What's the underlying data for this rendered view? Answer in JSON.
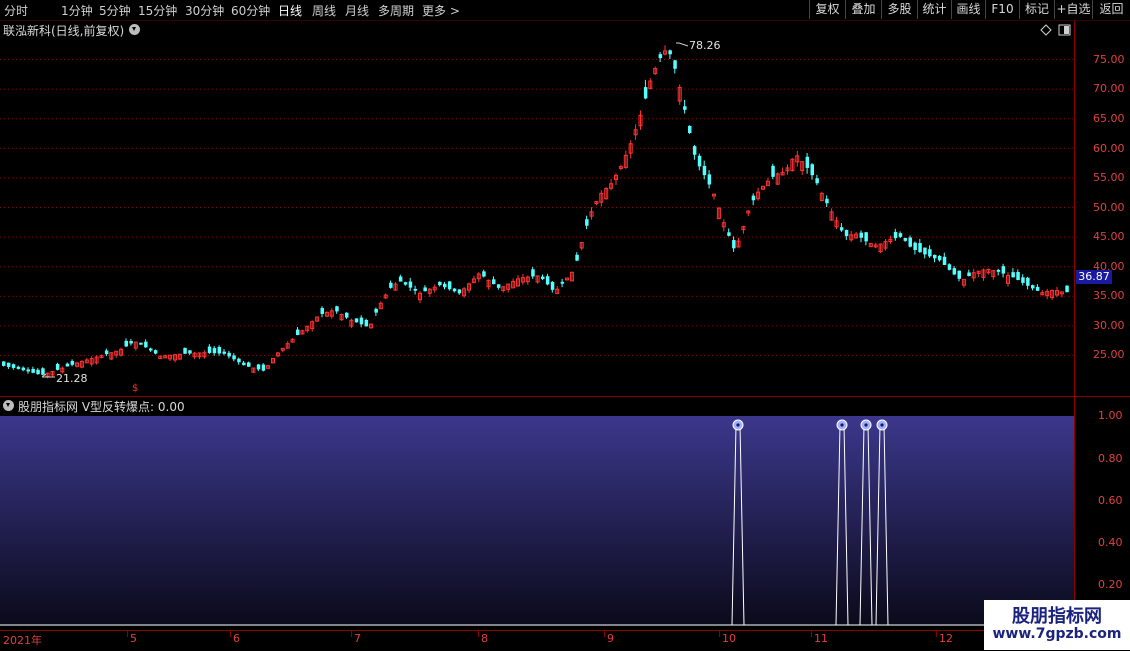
{
  "toolbar": {
    "periods": [
      "分时",
      "1分钟",
      "5分钟",
      "15分钟",
      "30分钟",
      "60分钟",
      "日线",
      "周线",
      "月线",
      "多周期",
      "更多 >"
    ],
    "active_period": "日线",
    "right_buttons": [
      "复权",
      "叠加",
      "多股",
      "统计",
      "画线",
      "F10",
      "标记",
      "+自选",
      "返回"
    ]
  },
  "stock": {
    "title": "联泓新科(日线,前复权)",
    "high_marker": "78.26",
    "low_marker": "21.28",
    "current_price": "36.87"
  },
  "price_axis": {
    "labels": [
      "75.00",
      "70.00",
      "65.00",
      "60.00",
      "55.00",
      "50.00",
      "45.00",
      "40.00",
      "35.00",
      "30.00",
      "25.00"
    ]
  },
  "indicator": {
    "title": "股朋指标网 V型反转爆点: 0.00",
    "axis_labels": [
      "1.00",
      "0.80",
      "0.60",
      "0.40",
      "0.20"
    ],
    "signal_bars": 4
  },
  "date_axis": {
    "labels": [
      "2021年",
      "5",
      "6",
      "7",
      "8",
      "9",
      "10",
      "11",
      "12"
    ]
  },
  "watermark": {
    "title": "股朋指标网",
    "url": "www.7gpzb.com"
  },
  "colors": {
    "up": "#ff3333",
    "down": "#54ffff",
    "grid": "#8b0000",
    "indicator_fill_top": "#3c378c",
    "indicator_fill_bottom": "#0a0a1a"
  }
}
